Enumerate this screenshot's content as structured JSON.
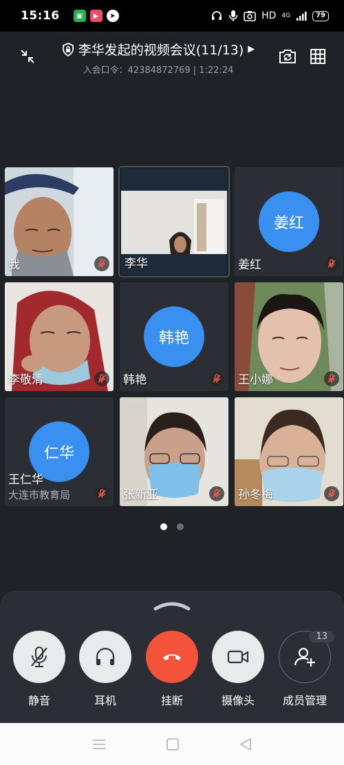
{
  "status": {
    "time": "15:16",
    "network": "HD",
    "signal": "4G",
    "battery": "79"
  },
  "header": {
    "title": "李华发起的视频会议(11/13)",
    "subtitle": "入会口令：42384872769 | 1:22:24"
  },
  "participants": [
    {
      "name": "我",
      "avatar_text": "",
      "muted": true,
      "video": true
    },
    {
      "name": "李华",
      "avatar_text": "",
      "muted": false,
      "video": true
    },
    {
      "name": "姜红",
      "avatar_text": "姜红",
      "muted": true,
      "video": false
    },
    {
      "name": "李敬清",
      "avatar_text": "",
      "muted": true,
      "video": true
    },
    {
      "name": "韩艳",
      "avatar_text": "韩艳",
      "muted": true,
      "video": false
    },
    {
      "name": "王小娜",
      "avatar_text": "",
      "muted": true,
      "video": true
    },
    {
      "name": "王仁华",
      "org": "大连市教育局",
      "avatar_text": "仁华",
      "muted": true,
      "video": false
    },
    {
      "name": "张新亚",
      "avatar_text": "",
      "muted": true,
      "video": true
    },
    {
      "name": "孙冬梅",
      "avatar_text": "",
      "muted": true,
      "video": true
    }
  ],
  "pager": {
    "pages": 2,
    "current": 1
  },
  "controls": {
    "mute_label": "静音",
    "earphone_label": "耳机",
    "hangup_label": "挂断",
    "camera_label": "摄像头",
    "members_label": "成员管理",
    "members_count": "13"
  },
  "colors": {
    "accent_blue": "#3a90f0",
    "hangup_red": "#f2533a",
    "background": "#1f2227"
  }
}
